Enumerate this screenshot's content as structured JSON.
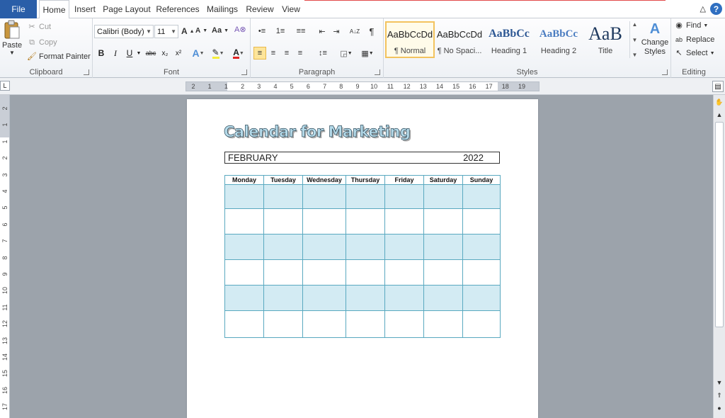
{
  "tabs": {
    "file": "File",
    "items": [
      "Home",
      "Insert",
      "Page Layout",
      "References",
      "Mailings",
      "Review",
      "View"
    ]
  },
  "clipboard": {
    "paste": "Paste",
    "cut": "Cut",
    "copy": "Copy",
    "format_painter": "Format Painter",
    "label": "Clipboard"
  },
  "font": {
    "family": "Calibri (Body)",
    "size": "11",
    "label": "Font",
    "case_button": "Aa",
    "bold": "B",
    "italic": "I",
    "underline": "U",
    "strike": "abc",
    "subscript": "x₂",
    "superscript": "x²",
    "grow": "A",
    "shrink": "A"
  },
  "paragraph": {
    "label": "Paragraph",
    "sort": "A↓Z",
    "pilcrow": "¶"
  },
  "styles": {
    "label": "Styles",
    "items": [
      {
        "sample": "AaBbCcDd",
        "name": "¶ Normal"
      },
      {
        "sample": "AaBbCcDd",
        "name": "¶ No Spaci..."
      },
      {
        "sample": "AaBbCc",
        "name": "Heading 1"
      },
      {
        "sample": "AaBbCc",
        "name": "Heading 2"
      },
      {
        "sample": "AaB",
        "name": "Title"
      }
    ],
    "change_styles": "Change Styles"
  },
  "editing": {
    "label": "Editing",
    "find": "Find",
    "replace": "Replace",
    "select": "Select"
  },
  "ruler": {
    "h_numbers": [
      "2",
      "1",
      "1",
      "2",
      "3",
      "4",
      "5",
      "6",
      "7",
      "8",
      "9",
      "10",
      "11",
      "12",
      "13",
      "14",
      "15",
      "16",
      "17",
      "18",
      "19"
    ],
    "v_numbers": [
      "2",
      "1",
      "1",
      "2",
      "3",
      "4",
      "5",
      "6",
      "7",
      "8",
      "9",
      "10",
      "11",
      "12",
      "13",
      "14",
      "15",
      "16",
      "17"
    ]
  },
  "document": {
    "title": "Calendar for Marketing",
    "month": "FEBRUARY",
    "year": "2022",
    "days": [
      "Monday",
      "Tuesday",
      "Wednesday",
      "Thursday",
      "Friday",
      "Saturday",
      "Sunday"
    ]
  },
  "colors": {
    "file_tab": "#2a5ea8",
    "cal_border": "#5aa9c0",
    "cal_shade": "#d3ebf3",
    "title_fill": "#b6dbea"
  }
}
